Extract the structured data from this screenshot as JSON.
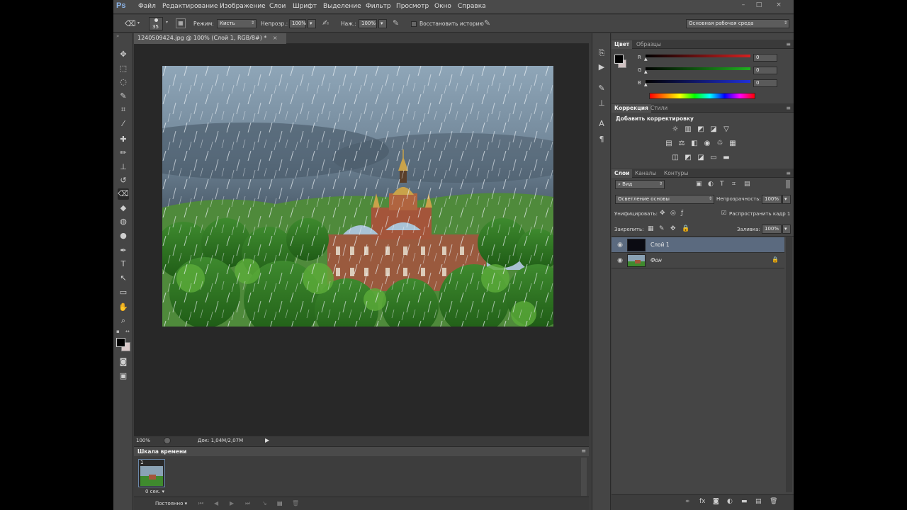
{
  "app": {
    "logo": "Ps",
    "menu": [
      "Файл",
      "Редактирование",
      "Изображение",
      "Слои",
      "Шрифт",
      "Выделение",
      "Фильтр",
      "Просмотр",
      "Окно",
      "Справка"
    ],
    "window_controls": [
      "–",
      "□",
      "×"
    ]
  },
  "options_bar": {
    "brush_size": "35",
    "mode_label": "Режим:",
    "mode_value": "Кисть",
    "opacity_label": "Непрозр.:",
    "opacity_value": "100%",
    "pressure_label": "Наж.:",
    "pressure_value": "100%",
    "restore_history_label": "Восстановить историю",
    "workspace": "Основная рабочая среда"
  },
  "document": {
    "tab_title": "1240509424.jpg @ 100% (Слой 1, RGB/8#) *",
    "tab_close": "×",
    "zoom": "100%",
    "doc_size": "Док: 1,04M/2,07M"
  },
  "timeline": {
    "title": "Шкала времени",
    "frame_number": "1",
    "frame_delay": "0 сек.",
    "loop": "Постоянно"
  },
  "color_panel": {
    "tabs": [
      "Цвет",
      "Образцы"
    ],
    "channels": [
      {
        "label": "R",
        "value": "0",
        "color": "#d42020"
      },
      {
        "label": "G",
        "value": "0",
        "color": "#20b020"
      },
      {
        "label": "B",
        "value": "0",
        "color": "#2030d8"
      }
    ]
  },
  "adjustments_panel": {
    "tabs": [
      "Коррекция",
      "Стили"
    ],
    "heading": "Добавить корректировку"
  },
  "layers_panel": {
    "tabs": [
      "Слои",
      "Каналы",
      "Контуры"
    ],
    "filter_kind": "Вид",
    "blend_mode": "Осветление основы",
    "opacity_label": "Непрозрачность:",
    "opacity_value": "100%",
    "unify_label": "Унифицировать:",
    "propagate_label": "Распространить кадр 1",
    "lock_label": "Закрепить:",
    "fill_label": "Заливка:",
    "fill_value": "100%",
    "layers": [
      {
        "name": "Слой 1",
        "selected": true
      },
      {
        "name": "Фон",
        "selected": false,
        "locked": true
      }
    ]
  },
  "colors": {
    "app_bg": "#3d3d3d",
    "canvas_bg": "#282828",
    "selected_layer": "#5b6a7f"
  }
}
